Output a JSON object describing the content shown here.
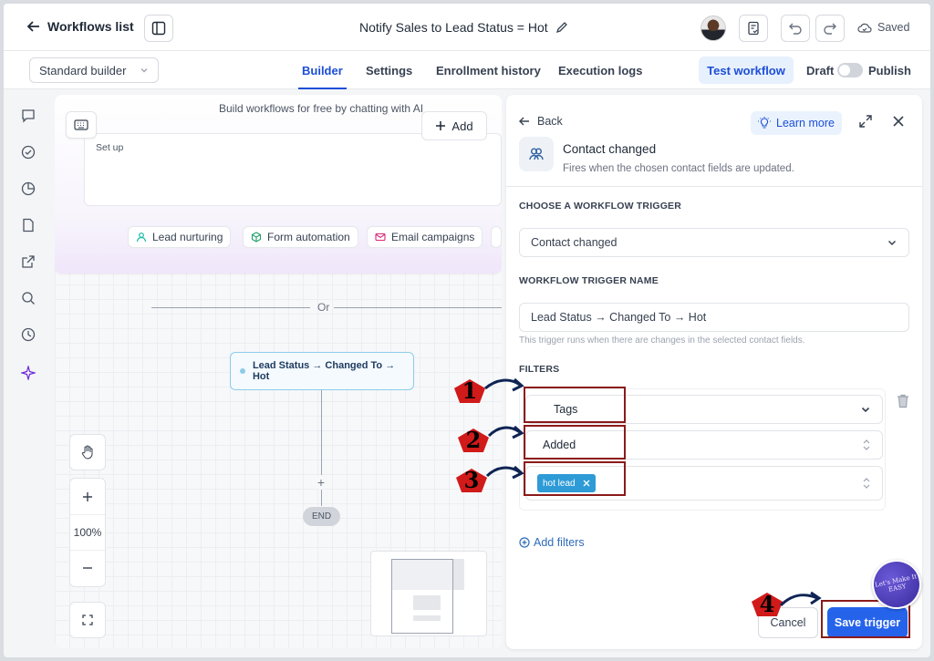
{
  "topbar": {
    "back_label": "Workflows list",
    "workflow_title": "Notify Sales to Lead Status = Hot",
    "saved_label": "Saved"
  },
  "subbar": {
    "builder_mode": "Standard builder",
    "tabs": [
      "Builder",
      "Settings",
      "Enrollment history",
      "Execution logs"
    ],
    "active_tab": "Builder",
    "test_label": "Test workflow",
    "draft_label": "Draft",
    "publish_label": "Publish"
  },
  "canvas": {
    "ai_heading": "Build workflows for free by chatting with AI",
    "add_label": "Add",
    "prompt_text": "Set up",
    "chips": [
      "Lead nurturing",
      "Form automation",
      "Email campaigns"
    ],
    "or_label": "Or",
    "trigger_node": "Lead Status → Changed To → Hot",
    "end_label": "END",
    "zoom_level": "100%"
  },
  "panel": {
    "back_label": "Back",
    "learn_more": "Learn more",
    "trigger_title": "Contact changed",
    "trigger_desc": "Fires when the chosen contact fields are updated.",
    "choose_label": "CHOOSE A WORKFLOW TRIGGER",
    "trigger_value": "Contact changed",
    "name_label": "WORKFLOW TRIGGER NAME",
    "name_value": "Lead Status → Changed To → Hot",
    "hint": "This trigger runs when there are changes in the selected contact fields.",
    "filters_label": "FILTERS",
    "filter_field": "Tags",
    "filter_operator": "Added",
    "filter_tag": "hot lead",
    "add_filters": "Add filters",
    "cancel_label": "Cancel",
    "save_label": "Save trigger"
  },
  "annotations": {
    "steps": [
      "1",
      "2",
      "3",
      "4"
    ],
    "badge_text": "Let's Make It EASY",
    "highlight_color": "#8b1a1a",
    "marker_color": "#d11a1a",
    "arrow_color": "#0f2454"
  },
  "colors": {
    "accent": "#1d4ed8",
    "primary_button": "#2563eb",
    "tag_chip": "#2e9bd6"
  }
}
